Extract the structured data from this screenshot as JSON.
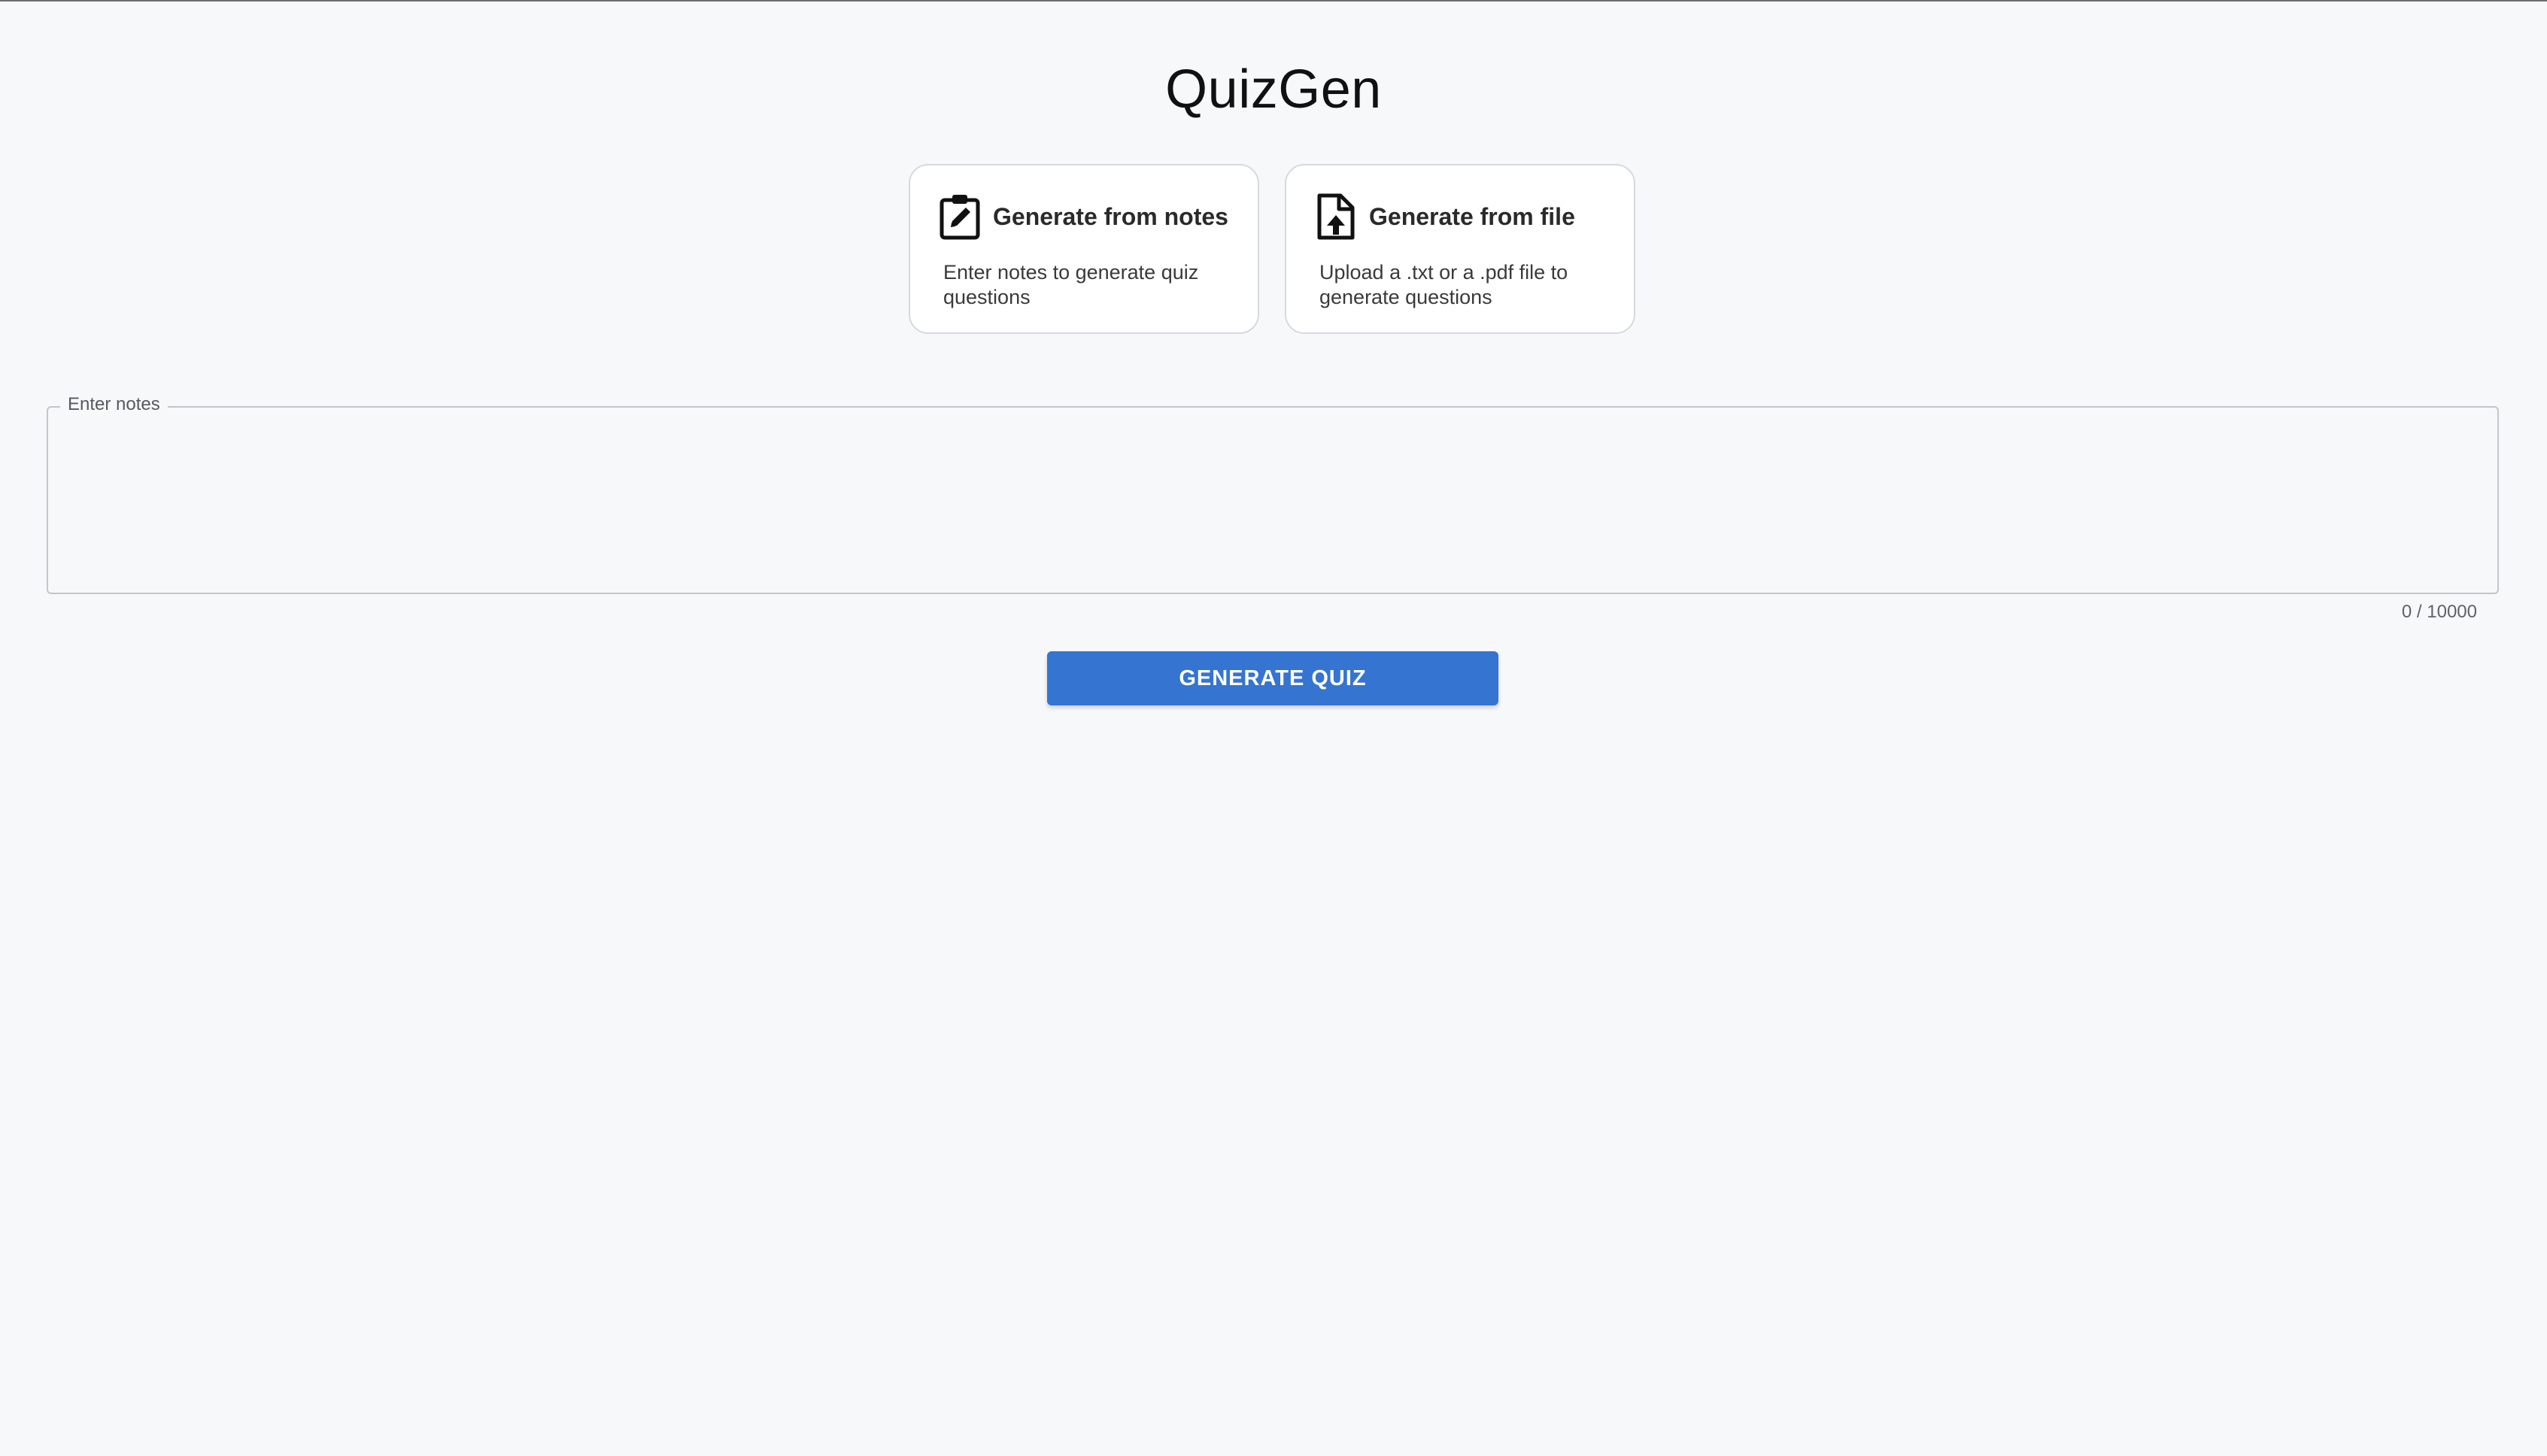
{
  "app": {
    "title": "QuizGen"
  },
  "modes": [
    {
      "id": "notes",
      "icon": "clipboard-edit-icon",
      "title": "Generate from notes",
      "description": "Enter notes to generate quiz questions"
    },
    {
      "id": "file",
      "icon": "file-upload-icon",
      "title": "Generate from file",
      "description": "Upload a .txt or a .pdf file to generate questions"
    }
  ],
  "notes_input": {
    "label": "Enter notes",
    "value": "",
    "counter": "0 / 10000"
  },
  "actions": {
    "generate_label": "GENERATE QUIZ"
  },
  "colors": {
    "background": "#f7f8fa",
    "primary_button": "#3574d1",
    "card_border": "#d7d9dd"
  }
}
